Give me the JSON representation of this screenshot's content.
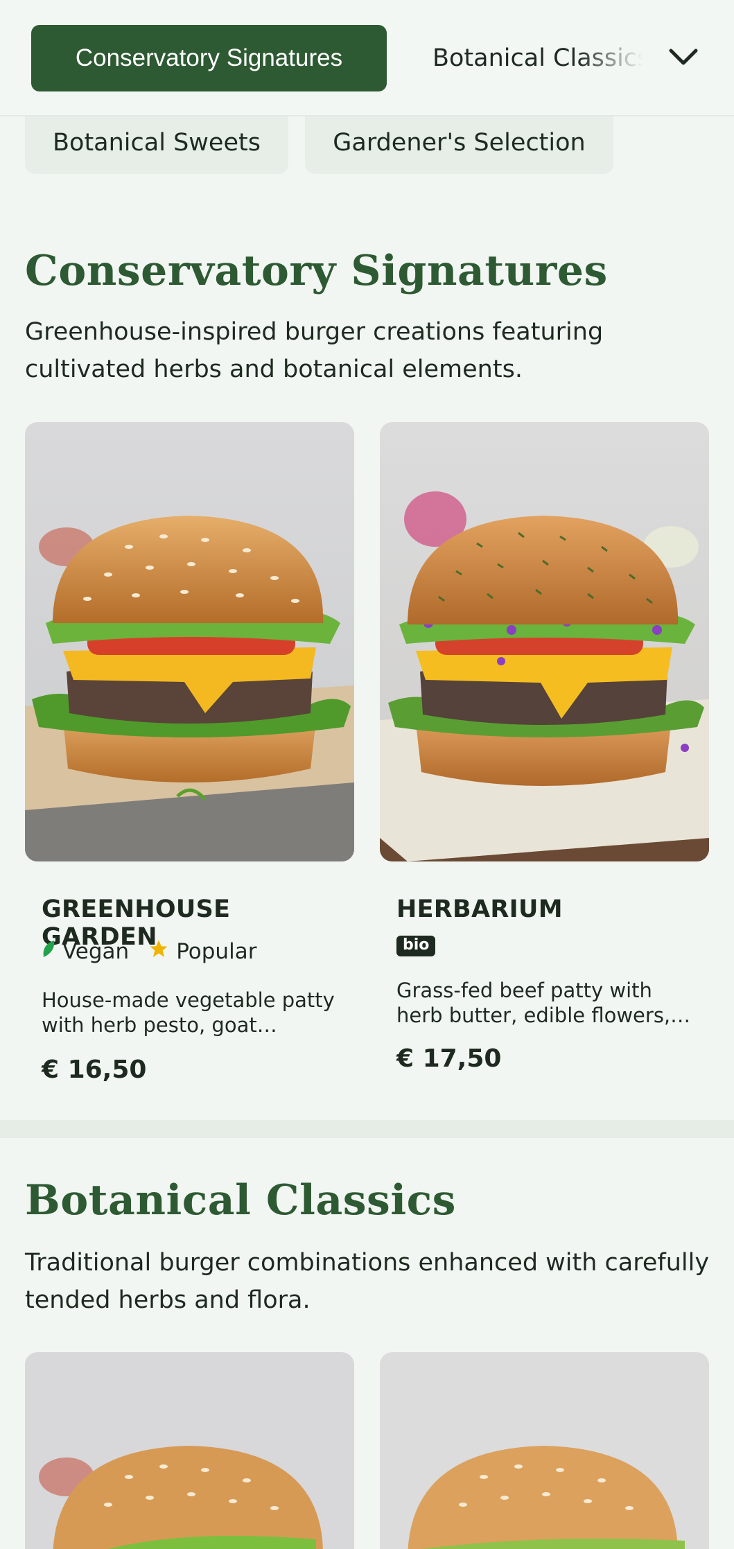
{
  "category_nav": {
    "active_tab": "Conservatory Signatures",
    "next_tab": "Botanical Classics",
    "row2_tabs": [
      "Botanical Sweets",
      "Gardener's Selection"
    ]
  },
  "sections": [
    {
      "title": "Conservatory Signatures",
      "description": "Greenhouse-inspired burger creations featuring cultivated herbs and botanical elements.",
      "items": [
        {
          "name": "GREENHOUSE GARDEN",
          "tags": [
            {
              "icon": "leaf-icon",
              "label": "Vegan",
              "color": "#22a34a"
            },
            {
              "icon": "star-icon",
              "label": "Popular",
              "color": "#f0b400"
            }
          ],
          "badge": "",
          "description": "House-made vegetable patty with herb pesto, goat cheese, fresh tomato and microgreens",
          "price": "€ 16,50"
        },
        {
          "name": "HERBARIUM",
          "tags": [],
          "badge": "bio",
          "description": "Grass-fed beef patty with herb butter, edible flowers, cheddar and garden greens",
          "price": "€ 17,50"
        }
      ]
    },
    {
      "title": "Botanical Classics",
      "description": "Traditional burger combinations enhanced with carefully tended herbs and flora."
    }
  ],
  "colors": {
    "accent": "#2e5a33",
    "background": "#f2f6f2",
    "text": "#1e2a20"
  }
}
